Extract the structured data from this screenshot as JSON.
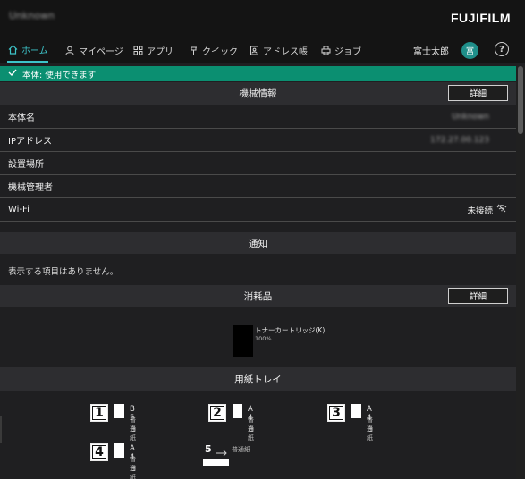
{
  "header": {
    "device_name": "Unknown",
    "brand": "FUJIFILM"
  },
  "nav": {
    "items": [
      {
        "label": "ホーム",
        "icon": "home-icon"
      },
      {
        "label": "マイページ",
        "icon": "user-icon"
      },
      {
        "label": "アプリ",
        "icon": "apps-icon"
      },
      {
        "label": "クイック",
        "icon": "pin-icon"
      },
      {
        "label": "アドレス帳",
        "icon": "address-book-icon"
      },
      {
        "label": "ジョブ",
        "icon": "printer-icon"
      }
    ],
    "user_name": "富士太郎",
    "avatar_text": "富",
    "help_label": "?"
  },
  "status": {
    "text": "本体: 使用できます",
    "color": "#0b8f71"
  },
  "machine_info": {
    "title": "機械情報",
    "detail_button": "詳細",
    "rows": [
      {
        "label": "本体名",
        "value": "Unknown"
      },
      {
        "label": "IPアドレス",
        "value": "172.27.00.123"
      },
      {
        "label": "設置場所",
        "value": ""
      },
      {
        "label": "機械管理者",
        "value": ""
      },
      {
        "label": "Wi-Fi",
        "value": "未接続"
      }
    ]
  },
  "notifications": {
    "title": "通知",
    "empty_text": "表示する項目はありません。"
  },
  "consumables": {
    "title": "消耗品",
    "detail_button": "詳細",
    "toner_name": "トナーカートリッジ(K)",
    "toner_level": "100%"
  },
  "paper_trays": {
    "title": "用紙トレイ",
    "trays": [
      {
        "number": "1",
        "size": "B 5",
        "type": "普通紙",
        "color": "白"
      },
      {
        "number": "2",
        "size": "A 4",
        "type": "普通紙",
        "color": "白"
      },
      {
        "number": "3",
        "size": "A 4",
        "type": "普通紙",
        "color": "白"
      },
      {
        "number": "4",
        "size": "A 4",
        "type": "普通紙",
        "color": "白"
      }
    ],
    "bypass": {
      "number": "5",
      "type": "普通紙"
    }
  }
}
